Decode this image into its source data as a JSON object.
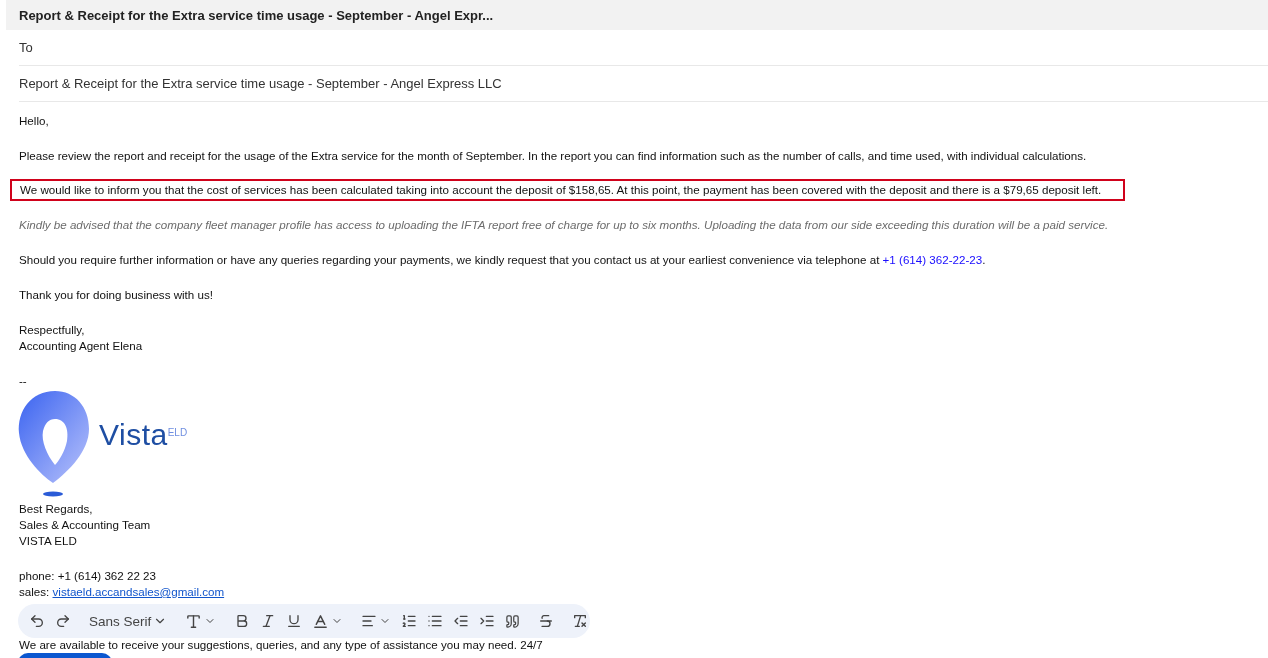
{
  "header": {
    "title": "Report & Receipt for the Extra service time usage - September - Angel Expr..."
  },
  "to_label": "To",
  "subject": "Report & Receipt for the Extra service time usage - September - Angel Express LLC",
  "body": [
    {
      "kind": "plain",
      "text": "Hello,"
    },
    {
      "kind": "plain",
      "text": "Please review the report and receipt for the usage of the Extra service for the month of September. In the report you can find information such as the number of calls, and time used, with individual calculations."
    },
    {
      "kind": "boxed",
      "text": "We would like to inform you that the cost of services has been calculated taking into account the deposit of $158,65. At this point, the payment has been covered with the deposit and there is a $79,65 deposit left."
    },
    {
      "kind": "note",
      "text": "Kindly be advised that the company fleet manager profile has access to uploading the IFTA report free of charge for up to six months. Uploading the data from our side exceeding this duration will be a paid service."
    },
    {
      "kind": "plain",
      "text": "Should you require further information or have any queries regarding your payments, we kindly request that you contact us at your earliest convenience via telephone at ",
      "link": "+1 (614) 362-22-23",
      "after": "."
    },
    {
      "kind": "plain",
      "text": "Thank you for doing business with us!"
    }
  ],
  "closing": [
    "Respectfully,",
    "Accounting Agent Elena"
  ],
  "separator": "--",
  "logo": {
    "word": "Vista",
    "sup": "ELD"
  },
  "signature": [
    "Best Regards,",
    "Sales & Accounting Team",
    "VISTA ELD"
  ],
  "phone_line": "phone: +1 (614) 362 22 23",
  "sales": {
    "label": "sales: ",
    "email": "vistaeld.accandsales@gmail.com"
  },
  "availability": "We are available to receive your suggestions, queries, and any type of assistance you may need. 24/7",
  "toolbar": {
    "font": "Sans Serif"
  }
}
